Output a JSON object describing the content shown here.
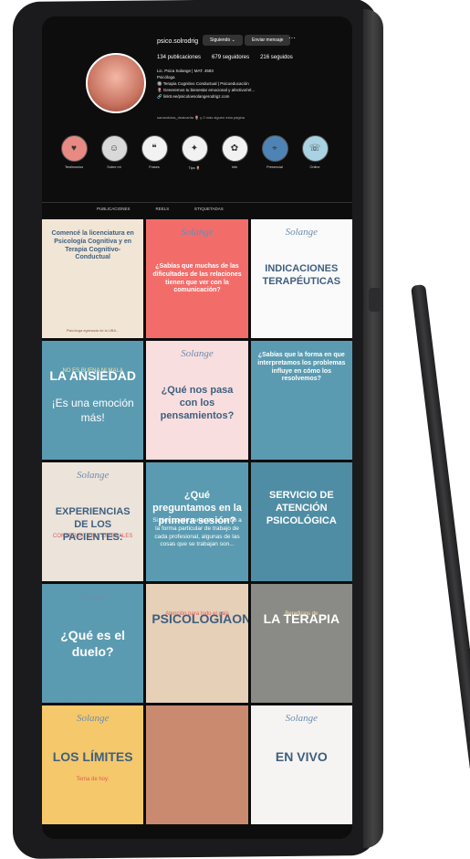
{
  "profile": {
    "username": "psico.solrodrig",
    "follow_button": "Siguiendo ⌄",
    "message_button": "Enviar mensaje",
    "more": "···",
    "stats": [
      "134 publicaciones",
      "679 seguidores",
      "216 seguidos"
    ],
    "bio_lines": [
      "Lic. Psica Solange | MAT. 4583",
      "Psicóloga",
      "🔘 Terapia Cognitivo Conductual | Psicoeducación",
      "🌷 Generemos tu bienestar emocional y afectivo/rel...",
      "🔗 linktr.ee/psicoloesolangerodrigz.com"
    ],
    "followed_by": "sanandolas_dealcarita 🌷 y 2 más siguen esta página"
  },
  "highlights": [
    {
      "label": "Testimonios",
      "icon": "heart-hands-icon",
      "bg": "#e88a83"
    },
    {
      "label": "Sobre mí",
      "icon": "profile-icon",
      "bg": "#d9d9d9"
    },
    {
      "label": "Frases",
      "icon": "quote-icon",
      "bg": "#f2f2f2"
    },
    {
      "label": "Tips 🌷",
      "icon": "bulb-icon",
      "bg": "#f2f2f2"
    },
    {
      "label": "Info",
      "icon": "brain-icon",
      "bg": "#f2f2f2"
    },
    {
      "label": "Presencial",
      "icon": "location-icon",
      "bg": "#4d84b5"
    },
    {
      "label": "Online",
      "icon": "online-icon",
      "bg": "#a9d3e2"
    }
  ],
  "tabs": [
    "PUBLICACIONES",
    "REELS",
    "ETIQUETADAS"
  ],
  "posts": [
    {
      "bg": "#f1e6d6",
      "title": "Comencé la licenciatura en Psicología Cognitiva y en Terapia Cognitivo-Conductual",
      "caption": "Psicóloga egresada de la UBA..."
    },
    {
      "bg": "#f26d6a",
      "title": "¿Sabías que muchas de las dificultades de las relaciones tienen que ver con la comunicación?",
      "logo": "Solange"
    },
    {
      "bg": "#fafafa",
      "title": "INDICACIONES TERAPÉUTICAS",
      "logo": "Solange"
    },
    {
      "bg": "#5b9bb1",
      "title": "LA ANSIEDAD",
      "sub": "NO ES BUENA NI MALA",
      "body": "¡Es una emoción más!"
    },
    {
      "bg": "#f8dede",
      "title": "¿Qué nos pasa con los pensamientos?",
      "logo": "Solange"
    },
    {
      "bg": "#5b9bb1",
      "title": "¿Sabías que la forma en que interpretamos los problemas influye en cómo los resolvemos?"
    },
    {
      "bg": "#ece4da",
      "title": "EXPERIENCIAS DE LOS PACIENTES:",
      "sub": "CONVERSATIONS LATERALES",
      "logo": "Solange"
    },
    {
      "bg": "#5b9bb1",
      "title": "¿Qué preguntamos en la primera sesión?",
      "body": "Si bien puede variar de acuerdo a la forma particular de trabajo de cada profesional, algunas de las cosas que se trabajan son..."
    },
    {
      "bg": "#4f8da4",
      "title": "SERVICIO DE ATENCIÓN PSICOLÓGICA"
    },
    {
      "bg": "#5b9bb1",
      "title": "¿Qué es el duelo?",
      "logo": "Solange"
    },
    {
      "bg": "#e6d0b8",
      "title": "PSICOLOGÍAONLINE",
      "sub": "Atención para todo el país"
    },
    {
      "bg": "#8a8a86",
      "title": "LA TERAPIA",
      "sub": "Beneficios de"
    },
    {
      "bg": "#f5c86b",
      "title": "LOS LÍMITES",
      "sub": "Tema de hoy:",
      "logo": "Solange"
    },
    {
      "bg": "#c98a6f",
      "title": ""
    },
    {
      "bg": "#f6f4f2",
      "title": "EN VIVO",
      "logo": "Solange"
    }
  ]
}
